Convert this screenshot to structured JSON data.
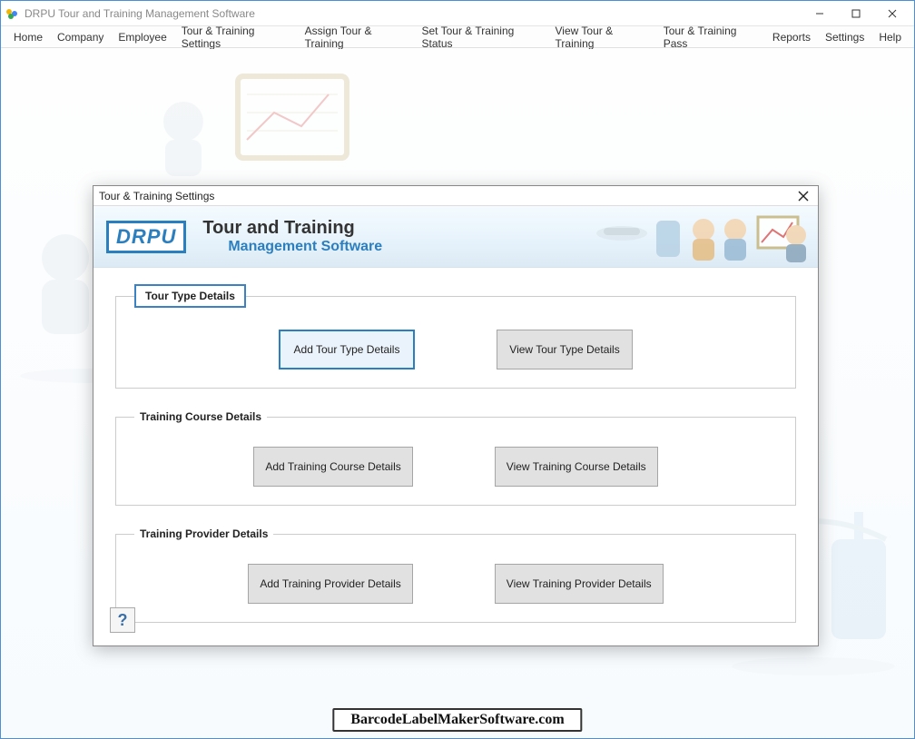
{
  "window": {
    "title": "DRPU Tour and Training Management Software"
  },
  "menu": {
    "items": [
      "Home",
      "Company",
      "Employee",
      "Tour & Training Settings",
      "Assign Tour & Training",
      "Set Tour & Training Status",
      "View Tour & Training",
      "Tour & Training Pass",
      "Reports",
      "Settings",
      "Help"
    ]
  },
  "dialog": {
    "title": "Tour & Training Settings",
    "logo_text": "DRPU",
    "header_line1": "Tour and Training",
    "header_line2": "Management Software",
    "groups": [
      {
        "legend": "Tour Type Details",
        "buttons": [
          "Add Tour Type Details",
          "View Tour Type Details"
        ],
        "selected_index": 0
      },
      {
        "legend": "Training Course Details",
        "buttons": [
          "Add Training Course Details",
          "View Training Course Details"
        ]
      },
      {
        "legend": "Training Provider Details",
        "buttons": [
          "Add Training Provider Details",
          "View Training Provider Details"
        ]
      }
    ]
  },
  "footer": {
    "text": "BarcodeLabelMakerSoftware.com"
  }
}
